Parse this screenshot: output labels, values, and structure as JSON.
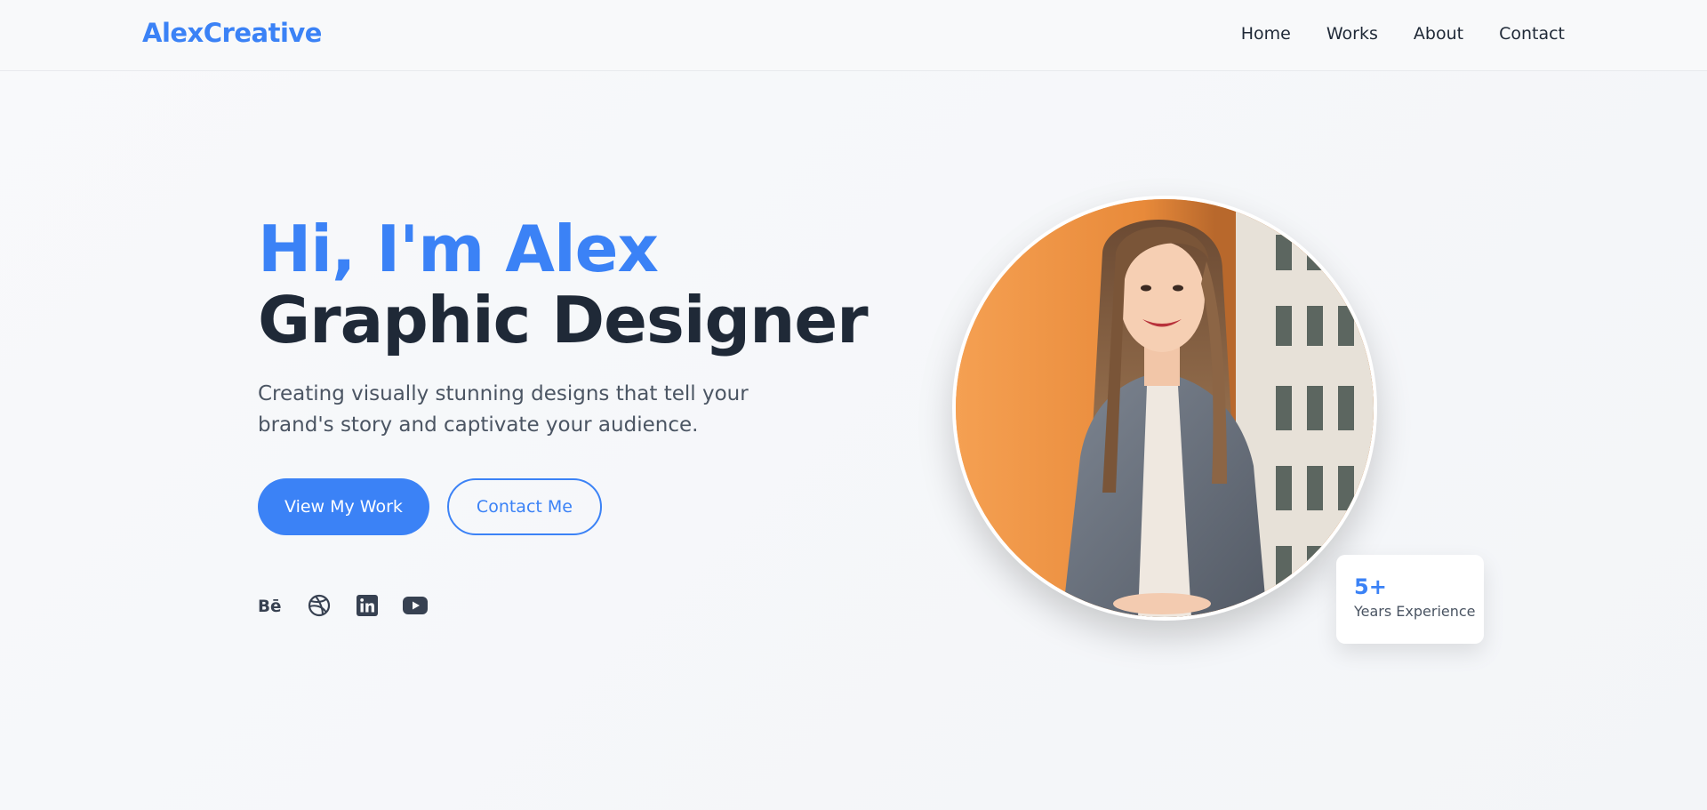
{
  "header": {
    "logo": "AlexCreative",
    "nav": [
      "Home",
      "Works",
      "About",
      "Contact"
    ]
  },
  "hero": {
    "greeting": "Hi, I'm Alex",
    "role": "Graphic Designer",
    "description": "Creating visually stunning designs that tell your brand's story and captivate your audience.",
    "primary_button": "View My Work",
    "secondary_button": "Contact Me",
    "socials": [
      "behance-icon",
      "dribbble-icon",
      "linkedin-icon",
      "youtube-icon"
    ]
  },
  "badge": {
    "value": "5+",
    "label": "Years Experience"
  },
  "colors": {
    "accent": "#3b82f6",
    "heading": "#1f2937",
    "body": "#4b5563",
    "background": "#f8f9fa"
  }
}
